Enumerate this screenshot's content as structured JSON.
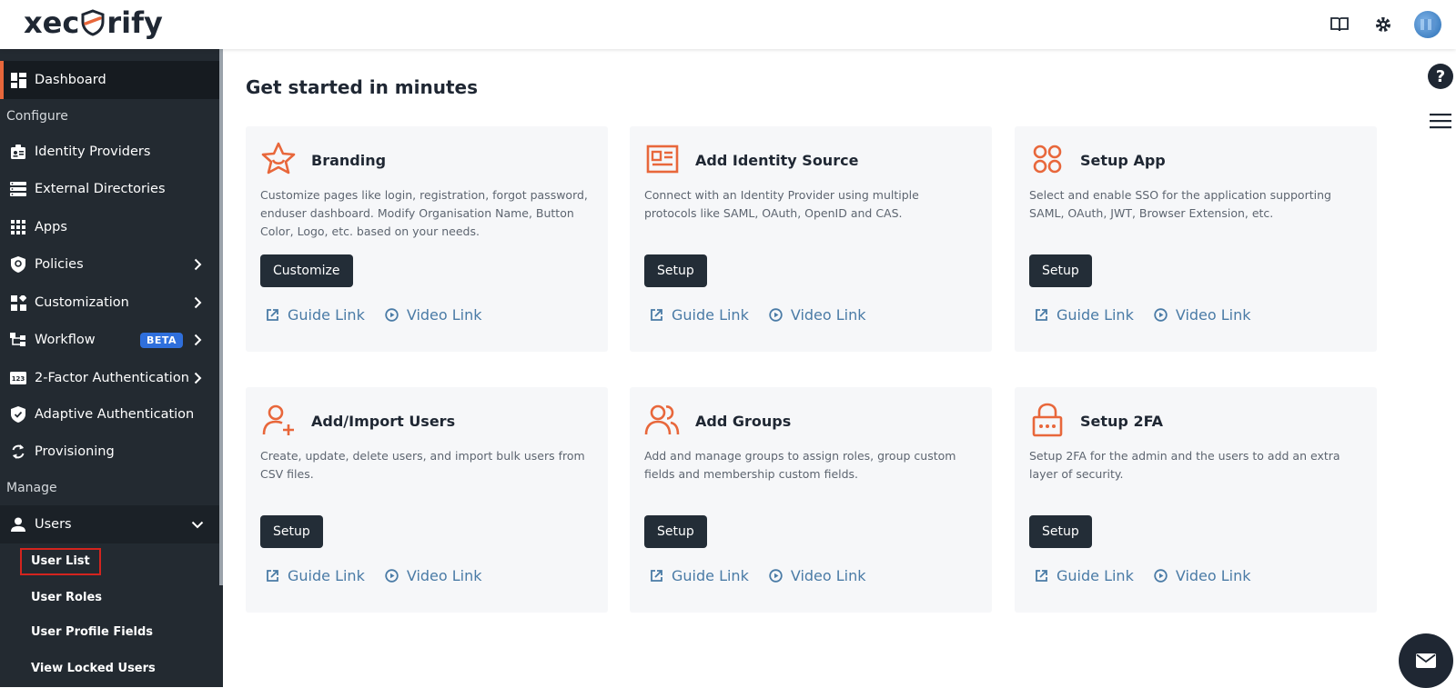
{
  "header": {
    "logo_text_left": "xec",
    "logo_text_right": "rify"
  },
  "sidebar": {
    "dashboard": "Dashboard",
    "configure_label": "Configure",
    "items": [
      {
        "label": "Identity Providers"
      },
      {
        "label": "External Directories"
      },
      {
        "label": "Apps"
      },
      {
        "label": "Policies"
      },
      {
        "label": "Customization"
      },
      {
        "label": "Workflow",
        "badge": "BETA"
      },
      {
        "label": "2-Factor Authentication"
      },
      {
        "label": "Adaptive Authentication"
      },
      {
        "label": "Provisioning"
      }
    ],
    "manage_label": "Manage",
    "users": "Users",
    "sub_items": [
      "User List",
      "User Roles",
      "User Profile Fields",
      "View Locked Users"
    ]
  },
  "main": {
    "title": "Get started in minutes",
    "guide_link": "Guide Link",
    "video_link": "Video Link",
    "cards": [
      {
        "title": "Branding",
        "desc": "Customize pages like login, registration, forgot password, enduser dashboard. Modify Organisation Name, Button Color, Logo, etc. based on your needs.",
        "button": "Customize",
        "icon": "star-icon"
      },
      {
        "title": "Add Identity Source",
        "desc": "Connect with an Identity Provider using multiple protocols like SAML, OAuth, OpenID and CAS.",
        "button": "Setup",
        "icon": "id-card-icon"
      },
      {
        "title": "Setup App",
        "desc": "Select and enable SSO for the application supporting SAML, OAuth, JWT, Browser Extension, etc.",
        "button": "Setup",
        "icon": "apps-grid-icon"
      },
      {
        "title": "Add/Import Users",
        "desc": "Create, update, delete users, and import bulk users from CSV files.",
        "button": "Setup",
        "icon": "user-plus-icon"
      },
      {
        "title": "Add Groups",
        "desc": "Add and manage groups to assign roles, group custom fields and membership custom fields.",
        "button": "Setup",
        "icon": "users-icon"
      },
      {
        "title": "Setup 2FA",
        "desc": "Setup 2FA for the admin and the users to add an extra layer of security.",
        "button": "Setup",
        "icon": "lock-icon"
      }
    ]
  },
  "right_rail": {
    "help": "?"
  },
  "colors": {
    "accent": "#e8673b",
    "sidebar_bg": "#232a31",
    "button_bg": "#232d37",
    "link": "#4a7ba6",
    "beta": "#2f6fdc"
  }
}
